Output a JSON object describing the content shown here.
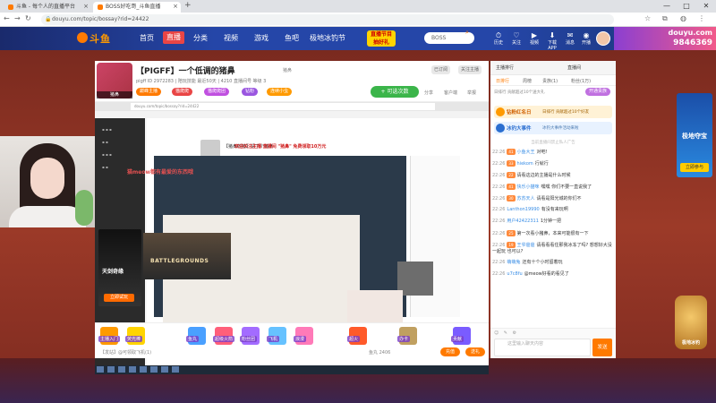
{
  "browser": {
    "tabs": [
      {
        "label": "斗鱼 - 每个人的直播平台",
        "active": false
      },
      {
        "label": "BOSS好吃哥_斗鱼直播",
        "active": true
      }
    ],
    "new_tab": "+",
    "window_controls": [
      "—",
      "□",
      "✕"
    ],
    "url": "douyu.com/topic/bossay?rid=24422",
    "colors": {
      "accent": "#ff7a00"
    }
  },
  "site": {
    "nav": {
      "items": [
        "首页",
        "直播",
        "分类",
        "视频",
        "游戏",
        "鱼吧",
        "极地冰钓节"
      ],
      "active_index": 1,
      "promo": "直播节目 抽好礼",
      "search_placeholder": "BOSS",
      "tools": [
        {
          "icon": "history-icon",
          "glyph": "⏱",
          "label": "历史"
        },
        {
          "icon": "follow-icon",
          "glyph": "♡",
          "label": "关注"
        },
        {
          "icon": "video-icon",
          "glyph": "▶",
          "label": "视频"
        },
        {
          "icon": "download-icon",
          "glyph": "⬇",
          "label": "下载APP"
        },
        {
          "icon": "message-icon",
          "glyph": "✉",
          "label": "消息"
        },
        {
          "icon": "live-icon",
          "glyph": "◉",
          "label": "开播"
        }
      ],
      "ad_title": "douyu.com",
      "ad_number": "9846369"
    }
  },
  "room": {
    "title": "【PIGFF】一个低调的猪鼻",
    "category_tag": "猪鼻",
    "meta": [
      "pigff",
      "2972283",
      "直播",
      "陪玩",
      "52",
      "小时",
      "4210",
      "直播间"
    ],
    "meta_line": "pigff  ID 2972283  |  陪玩技能  最近50天  |  4210 直播间号  等级 3",
    "badges": [
      {
        "text": "巅峰主播",
        "color": "#ff7a00"
      },
      {
        "text": "猫爬爬",
        "color": "#e94545"
      },
      {
        "text": "猫爬爬团",
        "color": "#c050e0"
      },
      {
        "text": "钻粉",
        "color": "#9a56e0"
      },
      {
        "text": "连续小虫",
        "color": "#ff9a00"
      }
    ],
    "follow_label": "+ 可选次数",
    "follow_count": "1",
    "actions": [
      "分享",
      "客户端",
      "举报"
    ],
    "top_buttons": [
      "已订阅",
      "关注主播"
    ],
    "notice_red": "欢迎关注主播 直播间 \"猪鼻\" 免费领取10万元",
    "left_notice": "猫meow都有最爱的东西哦",
    "game_card": {
      "title": "天剑奇缘",
      "button": "立即试玩"
    },
    "inner_anchor": "【猪鼻的猪】请了个猪鼻",
    "stream_game": "BATTLEGROUNDS"
  },
  "gifts": {
    "items": [
      {
        "label": "主播入门",
        "color": "#ff9a00"
      },
      {
        "label": "荧光棒",
        "color": "#ffd400"
      },
      {
        "label": "鱼丸",
        "color": "#4aa0ff"
      },
      {
        "label": "超级火箭",
        "color": "#ff5f7a"
      },
      {
        "label": "粉丝团",
        "color": "#a36cff"
      },
      {
        "label": "飞机",
        "color": "#66c2ff"
      },
      {
        "label": "浪漫",
        "color": "#ff7ab8"
      },
      {
        "label": "超火",
        "color": "#ff5a2a"
      },
      {
        "label": "办卡",
        "color": "#c0a060"
      },
      {
        "label": "贡献",
        "color": "#7a5cff"
      }
    ],
    "speak_label": "【发站】@可领取飞机(1)",
    "balance": "鱼丸 2406",
    "recharge": "充值",
    "pay": "送礼"
  },
  "chat": {
    "tabs": [
      "主播排行",
      "直播间"
    ],
    "rank_tabs": [
      "日排行",
      "周榜",
      "贵族(1)",
      "粉丝(1万)"
    ],
    "contributor": "日排行 贡献超过10个送大礼",
    "contrib_btn": "开通贵族",
    "banners": [
      {
        "title": "钻粉红名日",
        "sub": "日排行 贡献超过10个好友",
        "bg": "#fff2d6",
        "fg": "#d06000"
      },
      {
        "title": "冰钓大事件",
        "sub": "冰钓大事件活动来啦",
        "bg": "#e8f2ff",
        "fg": "#2a6ed0"
      }
    ],
    "notice": "当前直播间禁止私人广告",
    "messages": [
      {
        "t": "22:26",
        "lv": "41",
        "n": "小鱼大王",
        "m": "对吧!"
      },
      {
        "t": "22:26",
        "lv": "33",
        "n": "hiekom",
        "m": "行就行"
      },
      {
        "t": "22:26",
        "lv": "22",
        "n": "",
        "m": "请看这边的主播是什么时候"
      },
      {
        "t": "22:26",
        "lv": "41",
        "n": "快乐小猫咪",
        "m": "嘿嘿 你们不要一直说我了"
      },
      {
        "t": "22:26",
        "lv": "30",
        "n": "苏苏天人",
        "m": "请看是阳光城的你们不"
      },
      {
        "t": "22:26",
        "lv": "",
        "n": "Lanthon19990",
        "m": "有没有来玩啊"
      },
      {
        "t": "22:26",
        "lv": "",
        "n": "用户42422311",
        "m": "1分钟一把"
      },
      {
        "t": "22:26",
        "lv": "25",
        "n": "",
        "m": "第一次看小猪鼻，本来可能很有一下"
      },
      {
        "t": "22:26",
        "lv": "19",
        "n": "王爷爸爸",
        "m": "请看看看住那我冰冻了吗? 想想好大没一起玩 也可以?"
      },
      {
        "t": "22:26",
        "lv": "",
        "n": "萌萌兔",
        "m": "还有十个小时留着玩"
      },
      {
        "t": "22:26",
        "lv": "",
        "n": "u7c8fu",
        "m": "@meow好看的看见了"
      }
    ],
    "input_placeholder": "这里输入聊天内容",
    "send": "发送"
  },
  "side_ads": {
    "right_title": "极地夺宝",
    "right_button": "立即参与",
    "mascot": "极地冰钓"
  }
}
